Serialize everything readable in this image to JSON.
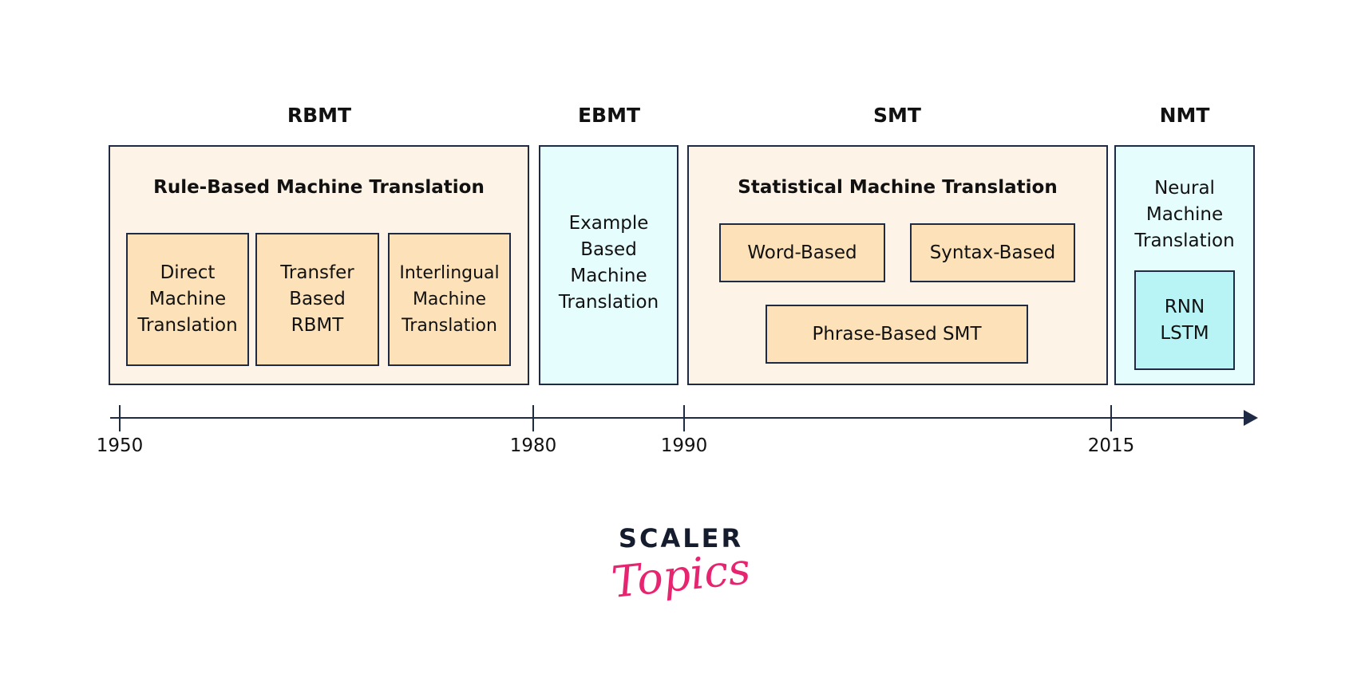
{
  "eras": [
    "RBMT",
    "EBMT",
    "SMT",
    "NMT"
  ],
  "rbmt": {
    "heading": "Rule-Based Machine Translation",
    "items": [
      "Direct Machine Translation",
      "Transfer Based RBMT",
      "Interlingual Machine Translation"
    ]
  },
  "ebmt": {
    "heading": "Example Based Machine Translation"
  },
  "smt": {
    "heading": "Statistical Machine Translation",
    "items": [
      "Word-Based",
      "Syntax-Based",
      "Phrase-Based SMT"
    ]
  },
  "nmt": {
    "heading": "Neural Machine Translation",
    "item": "RNN LSTM"
  },
  "timeline": [
    "1950",
    "1980",
    "1990",
    "2015"
  ],
  "logo": {
    "line1": "SCALER",
    "line2": "Topics"
  },
  "colors": {
    "border": "#1f2a44",
    "peach": "#fdf3e6",
    "inner": "#fde1b8",
    "cyan": "#e6fdfd",
    "rnn": "#b8f3f5",
    "logo_pink": "#e6246f"
  }
}
